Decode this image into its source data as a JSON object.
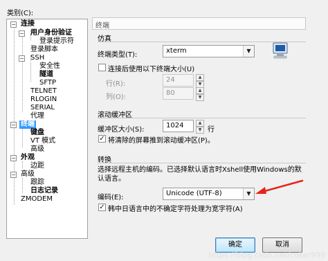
{
  "category_label": "类别(C):",
  "tree": [
    {
      "label": "连接",
      "bold": true
    },
    {
      "label": "用户身份验证",
      "bold": true
    },
    {
      "label": "登录提示符"
    },
    {
      "label": "登录脚本"
    },
    {
      "label": "SSH"
    },
    {
      "label": "安全性"
    },
    {
      "label": "隧道",
      "bold": true
    },
    {
      "label": "SFTP"
    },
    {
      "label": "TELNET"
    },
    {
      "label": "RLOGIN"
    },
    {
      "label": "SERIAL"
    },
    {
      "label": "代理"
    },
    {
      "label": "终端",
      "bold": true,
      "selected": true
    },
    {
      "label": "键盘",
      "bold": true
    },
    {
      "label": "VT 模式"
    },
    {
      "label": "高级"
    },
    {
      "label": "外观",
      "bold": true
    },
    {
      "label": "边距"
    },
    {
      "label": "高级"
    },
    {
      "label": "跟踪"
    },
    {
      "label": "日志记录",
      "bold": true
    },
    {
      "label": "ZMODEM"
    }
  ],
  "panel_title": "终端",
  "emulation": {
    "section_title": "仿真",
    "terminal_type_label": "终端类型(T):",
    "terminal_type_value": "xterm",
    "resize_checkbox_label": "连接后使用以下终端大小(U)",
    "resize_checked": false,
    "rows_label": "行(R):",
    "rows_value": "24",
    "cols_label": "列(O):",
    "cols_value": "80"
  },
  "scrollback": {
    "section_title": "滚动缓冲区",
    "size_label": "缓冲区大小(S):",
    "size_value": "1024",
    "size_unit": "行",
    "push_checkbox_label": "将清除的屏幕推到滚动缓冲区(P)。",
    "push_checked": true
  },
  "translation": {
    "section_title": "转换",
    "description": "选择远程主机的编码。已选择默认语言时Xshell使用Windows的默认语言。",
    "encoding_label": "编码(E):",
    "encoding_value": "Unicode (UTF-8)",
    "cjk_checkbox_label": "韩中日语言中的不确定字符处理为宽字符(A)",
    "cjk_checked": true
  },
  "buttons": {
    "ok": "确定",
    "cancel": "取消"
  },
  "watermark": "https://blog.csdn.net/coker999",
  "colors": {
    "selection": "#3399ff",
    "arrow": "#e8221b"
  },
  "icons": {
    "check": "✓",
    "dropdown": "▼",
    "spin_up": "▲",
    "spin_down": "▼",
    "collapse": "−"
  }
}
